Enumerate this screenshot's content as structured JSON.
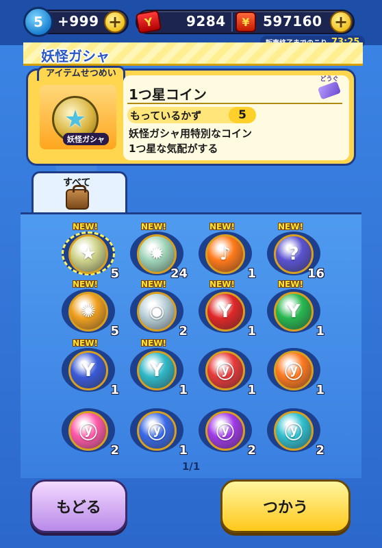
{
  "status": {
    "level_badge": "5",
    "stamina": "+999",
    "tickets": "9284",
    "money": "597160",
    "sale_label": "販売終了までのこり",
    "sale_timer": "73:25"
  },
  "title": "妖怪ガシャ",
  "item_card": {
    "tab_label": "アイテムせつめい",
    "tool_tag": "どうぐ",
    "name": "1つ星コイン",
    "owned_label": "もっているかず",
    "owned_count": "5",
    "gacha_label": "妖怪ガシャ",
    "description_1": "妖怪ガシャ用特別なコイン",
    "description_2": "1つ星な気配がする"
  },
  "category_tab": {
    "label": "すべて"
  },
  "new_label": "NEW!",
  "items": [
    {
      "icon": "star-coin",
      "count": "5",
      "new": true,
      "selected": true,
      "color": "#cfd38a",
      "glyph": "★"
    },
    {
      "icon": "sun-coin",
      "count": "24",
      "new": true,
      "color": "#9fd4b8",
      "glyph": "✹"
    },
    {
      "icon": "music-coin",
      "count": "1",
      "new": true,
      "color": "#ff7a1a",
      "glyph": "♪"
    },
    {
      "icon": "question-coin",
      "count": "16",
      "new": true,
      "color": "#5a52d0",
      "glyph": "?"
    },
    {
      "icon": "swirl-coin",
      "count": "5",
      "new": true,
      "color": "#f0a020",
      "glyph": "✺"
    },
    {
      "icon": "silver-coin",
      "count": "2",
      "new": true,
      "color": "#b8d0d8",
      "glyph": "◉"
    },
    {
      "icon": "red-y-coin",
      "count": "1",
      "new": true,
      "color": "#e02828",
      "glyph": "Y"
    },
    {
      "icon": "green-y-coin",
      "count": "1",
      "new": true,
      "color": "#28b850",
      "glyph": "Y"
    },
    {
      "icon": "blue-y-coin",
      "count": "1",
      "new": true,
      "color": "#3a5ad8",
      "glyph": "Y"
    },
    {
      "icon": "teal-y-coin",
      "count": "1",
      "new": true,
      "color": "#30b8c8",
      "glyph": "Y"
    },
    {
      "icon": "red-fire-coin",
      "count": "1",
      "new": false,
      "color": "#e83a3a",
      "glyph": "ⓨ"
    },
    {
      "icon": "orange-fire-coin",
      "count": "1",
      "new": false,
      "color": "#ff7a20",
      "glyph": "ⓨ"
    },
    {
      "icon": "pink-fire-coin",
      "count": "2",
      "new": false,
      "color": "#ff5aa8",
      "glyph": "ⓨ"
    },
    {
      "icon": "blue-fire-coin",
      "count": "1",
      "new": false,
      "color": "#3a6ae8",
      "glyph": "ⓨ"
    },
    {
      "icon": "purple-fire-coin",
      "count": "2",
      "new": false,
      "color": "#a03ae8",
      "glyph": "ⓨ"
    },
    {
      "icon": "cyan-fire-coin",
      "count": "2",
      "new": false,
      "color": "#30c0d0",
      "glyph": "ⓨ"
    }
  ],
  "pager": "1/1",
  "buttons": {
    "back": "もどる",
    "use": "つかう"
  }
}
